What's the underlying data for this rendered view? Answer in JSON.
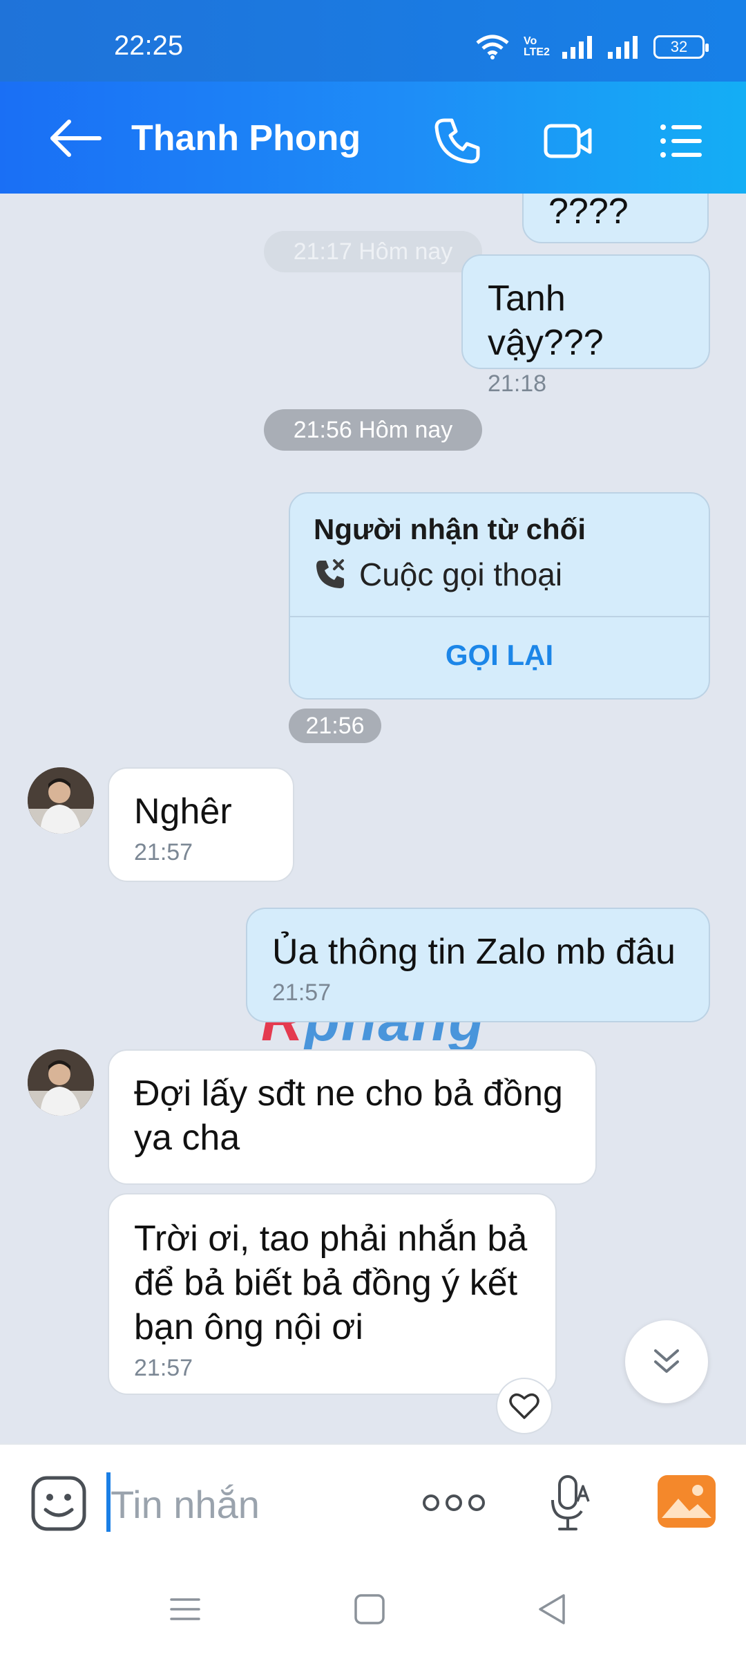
{
  "status_bar": {
    "time": "22:25",
    "network_label": "Vo LTE2",
    "battery": "32"
  },
  "header": {
    "contact_name": "Thanh Phong",
    "back_icon": "arrow-left-icon",
    "call_icon": "phone-icon",
    "video_icon": "video-camera-icon",
    "menu_icon": "list-menu-icon"
  },
  "messages": {
    "partial_top_text": "????",
    "faded_time_pill": "21:17 Hôm nay",
    "m1": {
      "text": "Tanh vậy???",
      "time": "21:18"
    },
    "time_pill": "21:56 Hôm nay",
    "call_card": {
      "title": "Người nhận từ chối",
      "subtitle": "Cuộc gọi thoại",
      "action": "GỌI LẠI",
      "time": "21:56"
    },
    "m2": {
      "text": "Nghêr",
      "time": "21:57"
    },
    "m3": {
      "text": "Ủa thông tin Zalo mb đâu",
      "time": "21:57"
    },
    "m4": {
      "text_line1": "Đợi lấy sđt ne cho bả đồng",
      "text_line2": "ya cha"
    },
    "m5": {
      "text_line1": "Trời ơi, tao phải nhắn bả",
      "text_line2": "để bả biết bả đồng ý kết",
      "text_line3": "bạn ông nội ơi",
      "time": "21:57"
    }
  },
  "watermark": {
    "first": "R",
    "rest": "phang"
  },
  "input_bar": {
    "placeholder": "Tin nhắn"
  },
  "colors": {
    "header_start": "#1a6ff5",
    "header_end": "#14aef5",
    "outgoing_bubble": "#d5ecfb",
    "incoming_bubble": "#ffffff",
    "chat_background": "#e1e6ef",
    "accent": "#1c86e8"
  }
}
